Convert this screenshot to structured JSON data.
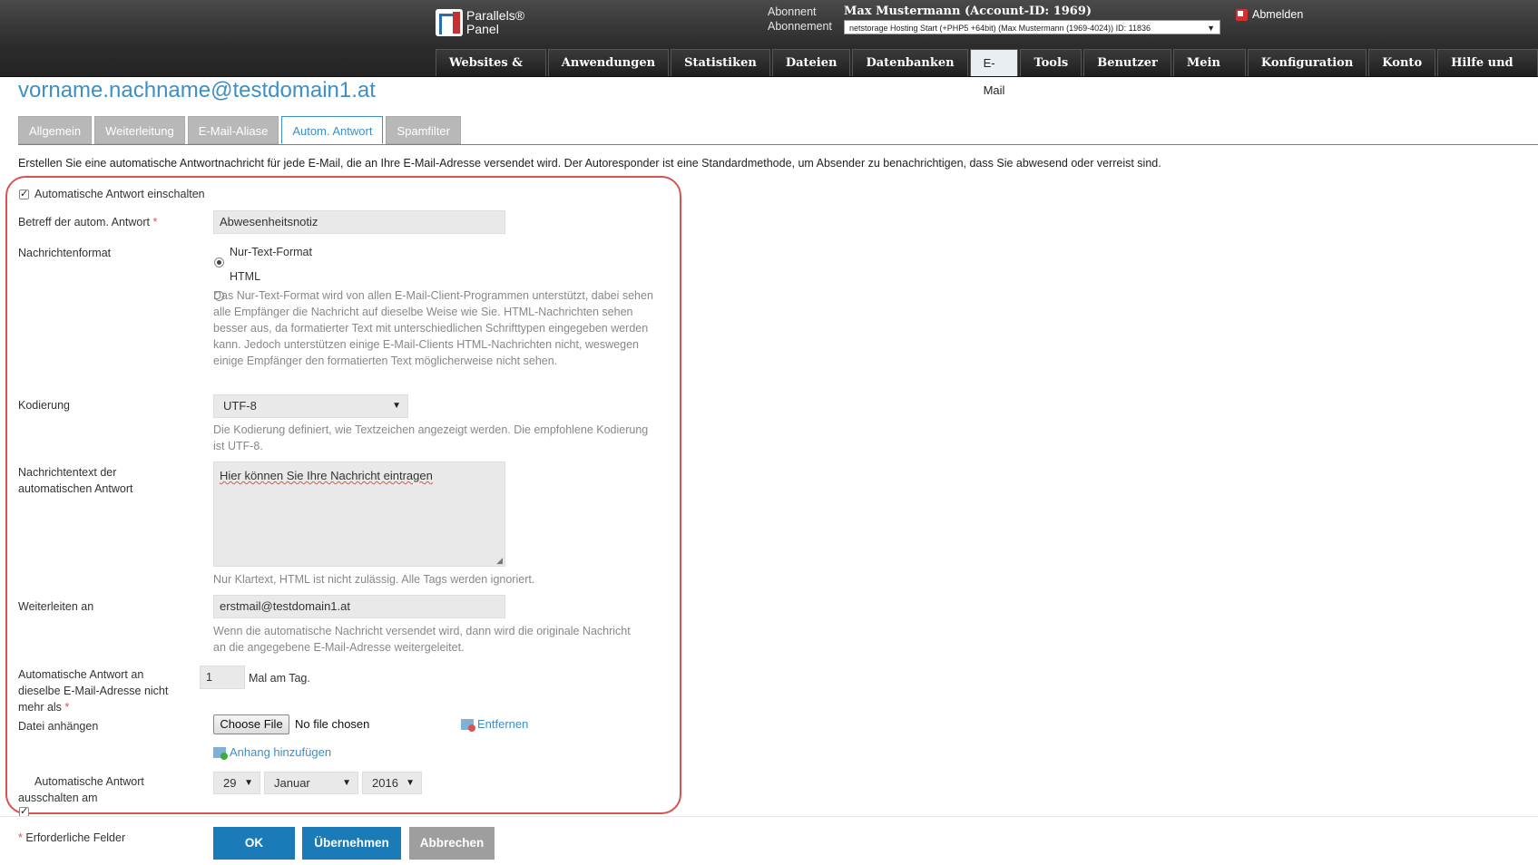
{
  "header": {
    "logo_line1": "Parallels®",
    "logo_line2": "Panel",
    "subscriber_label": "Abonnent",
    "subscriber_value": "Max Mustermann (Account-ID: 1969)",
    "subscription_label": "Abonnement",
    "subscription_value": "netstorage Hosting Start (+PHP5 +64bit) (Max Mustermann (1969-4024)) ID: 11836",
    "logout_label": "Abmelden"
  },
  "nav": {
    "tabs": [
      "Websites & Domains",
      "Anwendungen",
      "Statistiken",
      "Dateien",
      "Datenbanken",
      "E-Mail",
      "Tools",
      "Benutzer",
      "Mein Profil",
      "Konfiguration",
      "Konto",
      "Hilfe und Support"
    ],
    "active": "E-Mail"
  },
  "page": {
    "title": "vorname.nachname@testdomain1.at",
    "subtabs": [
      "Allgemein",
      "Weiterleitung",
      "E-Mail-Aliase",
      "Autom. Antwort",
      "Spamfilter"
    ],
    "active_subtab": "Autom. Antwort",
    "intro": "Erstellen Sie eine automatische Antwortnachricht für jede E-Mail, die an Ihre E-Mail-Adresse versendet wird. Der Autoresponder ist eine Standardmethode, um Absender zu benachrichtigen, dass Sie abwesend oder verreist sind."
  },
  "form": {
    "enable_label": "Automatische Antwort einschalten",
    "subject_label": "Betreff der autom. Antwort",
    "subject_value": "Abwesenheitsnotiz",
    "format_label": "Nachrichtenformat",
    "format_text": "Nur-Text-Format",
    "format_html": "HTML",
    "format_hint": "Das Nur-Text-Format wird von allen E-Mail-Client-Programmen unterstützt, dabei sehen alle Empfänger die Nachricht auf dieselbe Weise wie Sie. HTML-Nachrichten sehen besser aus, da formatierter Text mit unterschiedlichen Schrifttypen eingegeben werden kann. Jedoch unterstützen einige E-Mail-Clients HTML-Nachrichten nicht, weswegen einige Empfänger den formatierten Text möglicherweise nicht sehen.",
    "encoding_label": "Kodierung",
    "encoding_value": "UTF-8",
    "encoding_hint": "Die Kodierung definiert, wie Textzeichen angezeigt werden. Die empfohlene Kodierung ist UTF-8.",
    "message_label": "Nachrichtentext der automatischen Antwort",
    "message_value": "Hier können Sie Ihre Nachricht eintragen",
    "message_hint": "Nur Klartext, HTML ist nicht zulässig. Alle Tags werden ignoriert.",
    "forward_label": "Weiterleiten an",
    "forward_value": "erstmail@testdomain1.at",
    "forward_hint": "Wenn die automatische Nachricht versendet wird, dann wird die originale Nachricht an die angegebene E-Mail-Adresse weitergeleitet.",
    "limit_label": "Automatische Antwort an dieselbe E-Mail-Adresse nicht mehr als",
    "limit_value": "1",
    "limit_suffix": "Mal am Tag.",
    "attach_label": "Datei anhängen",
    "choose_file": "Choose File",
    "no_file": "No file chosen",
    "remove_label": "Entfernen",
    "add_attachment": "Anhang hinzufügen",
    "disable_label": "Automatische Antwort ausschalten am",
    "day": "29",
    "month": "Januar",
    "year": "2016",
    "required_star": "*",
    "required_note": "Erforderliche Felder"
  },
  "buttons": {
    "ok": "OK",
    "apply": "Übernehmen",
    "cancel": "Abbrechen"
  },
  "colors": {
    "accent": "#3d8fc6",
    "primary_button": "#1b7ab8",
    "cancel_button": "#9e9e9e",
    "highlight": "#d9534f"
  }
}
